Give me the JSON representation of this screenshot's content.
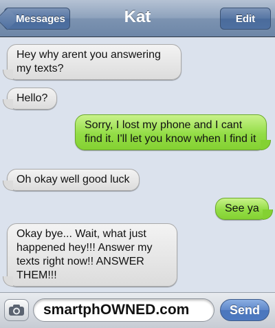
{
  "navbar": {
    "back_label": "Messages",
    "title": "Kat",
    "edit_label": "Edit"
  },
  "messages": [
    {
      "side": "received",
      "text": "Hey why arent you answering my texts?"
    },
    {
      "side": "received",
      "text": "Hello?"
    },
    {
      "side": "sent",
      "text": "Sorry, I lost my phone and I cant find it. I'll let you know when I find it"
    },
    {
      "side": "received",
      "text": "Oh okay well good luck"
    },
    {
      "side": "sent",
      "text": "See ya"
    },
    {
      "side": "received",
      "text": "Okay bye... Wait, what just happened hey!!! Answer my texts right now!! ANSWER THEM!!!"
    }
  ],
  "composer": {
    "camera_icon": "camera-icon",
    "text_value": "smartphOWNED.com",
    "send_label": "Send"
  },
  "colors": {
    "sent_bubble": "#93dd46",
    "received_bubble": "#e8e8e8",
    "navbar": "#7c93b1",
    "send_button": "#4b77bd"
  }
}
